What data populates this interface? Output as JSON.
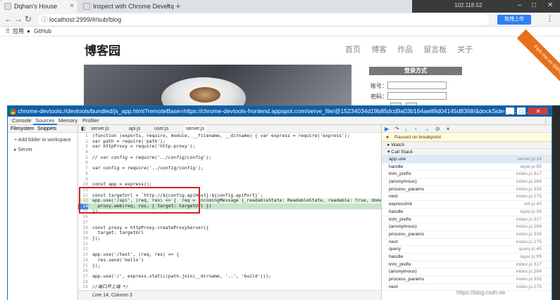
{
  "browser": {
    "tabs": [
      {
        "label": "Dqhan's House"
      },
      {
        "label": "Inspect with Chrome Developer"
      }
    ],
    "system_ip": "102.118.52",
    "url": "localhost:2999/#/sub/blog",
    "upload_button": "拖拽上传",
    "bookmarks": [
      {
        "label": "应用"
      },
      {
        "label": "GitHub"
      }
    ]
  },
  "blog": {
    "logo": "博客园",
    "nav": [
      "首页",
      "博客",
      "作品",
      "留言板",
      "关于"
    ],
    "ribbon": "Fork me on GitHub",
    "login_title": "登录方式",
    "username_label": "账号：",
    "password_label": "密码："
  },
  "devtools": {
    "window_title": "chrome-devtools://devtools/bundled/js_app.html?remoteBase=https://chrome-devtools-frontend.appspot.com/serve_file/@15234034d19b85dcd9a03b164ae89d04145d8368/&dockSide=undock...",
    "main_tabs": [
      "Console",
      "Sources",
      "Memory",
      "Profiler"
    ],
    "active_main_tab": "Sources",
    "nav_tabs": [
      "Filesystem",
      "Snippets"
    ],
    "add_folder": "+ Add folder to workspace",
    "folder": "Server",
    "file_tabs": [
      "server.js",
      "api.js",
      "user.js",
      "server.js"
    ],
    "status": "Line 14, Column 3",
    "code_lines": [
      {
        "n": "1",
        "t": "(function (exports, require, module, __filename, __dirname) { var express = require('express');"
      },
      {
        "n": "2",
        "t": "var path = require('path');"
      },
      {
        "n": "3",
        "t": "var httpProxy = require('http-proxy');"
      },
      {
        "n": "4",
        "t": ""
      },
      {
        "n": "5",
        "t": "// var config = require('../config/config');"
      },
      {
        "n": "6",
        "t": ""
      },
      {
        "n": "7",
        "t": "var config = require('../config/config');"
      },
      {
        "n": "8",
        "t": ""
      },
      {
        "n": "9",
        "t": ""
      },
      {
        "n": "10",
        "t": "const app = express();"
      },
      {
        "n": "11",
        "t": ""
      },
      {
        "n": "12",
        "t": "const targetUrl = `http://${config.apiHost}:${config.apiPort}`;"
      },
      {
        "n": "13",
        "t": "app.use('/api', (req, res) => {  req = IncomingMessage {_readableState: ReadableState, readable: true, domain: null, _events: Object"
      },
      {
        "n": "14",
        "t": "  proxy.web(req, res, { target: targetUrl })"
      },
      {
        "n": "15",
        "t": "});"
      },
      {
        "n": "16",
        "t": ""
      },
      {
        "n": "17",
        "t": ""
      },
      {
        "n": "18",
        "t": "const proxy = httpProxy.createProxyServer({"
      },
      {
        "n": "19",
        "t": "  target: targetUrl"
      },
      {
        "n": "20",
        "t": "});"
      },
      {
        "n": "21",
        "t": ""
      },
      {
        "n": "22",
        "t": ""
      },
      {
        "n": "23",
        "t": "app.use('/test', (req, res) => {"
      },
      {
        "n": "24",
        "t": "  res.send('hello')"
      },
      {
        "n": "25",
        "t": "});"
      },
      {
        "n": "26",
        "t": ""
      },
      {
        "n": "27",
        "t": "app.use('/', express.static(path.join(__dirname, '..', 'build')));"
      },
      {
        "n": "28",
        "t": ""
      },
      {
        "n": "29",
        "t": "//端口开上端 */"
      },
      {
        "n": "30",
        "t": "app.listen(2999, () => console.log('Example app listening on port 2999!'));"
      }
    ],
    "paused_message": "Paused on breakpoint",
    "watch_label": "▸ Watch",
    "callstack_label": "▾ Call Stack",
    "call_stack": [
      {
        "fn": "app.use",
        "loc": "server.js:14"
      },
      {
        "fn": "handle",
        "loc": "layer.js:95"
      },
      {
        "fn": "trim_prefix",
        "loc": "index.js:317"
      },
      {
        "fn": "(anonymous)",
        "loc": "index.js:284"
      },
      {
        "fn": "process_params",
        "loc": "index.js:335"
      },
      {
        "fn": "next",
        "loc": "index.js:275"
      },
      {
        "fn": "expressInit",
        "loc": "init.js:40"
      },
      {
        "fn": "handle",
        "loc": "layer.js:95"
      },
      {
        "fn": "trim_prefix",
        "loc": "index.js:317"
      },
      {
        "fn": "(anonymous)",
        "loc": "index.js:284"
      },
      {
        "fn": "process_params",
        "loc": "index.js:335"
      },
      {
        "fn": "next",
        "loc": "index.js:275"
      },
      {
        "fn": "query",
        "loc": "query.js:45"
      },
      {
        "fn": "handle",
        "loc": "layer.js:95"
      },
      {
        "fn": "trim_prefix",
        "loc": "index.js:317"
      },
      {
        "fn": "(anonymous)",
        "loc": "index.js:284"
      },
      {
        "fn": "process_params",
        "loc": "index.js:335"
      },
      {
        "fn": "next",
        "loc": "index.js:275"
      }
    ]
  },
  "watermark": "https://blog.csdn.ne"
}
